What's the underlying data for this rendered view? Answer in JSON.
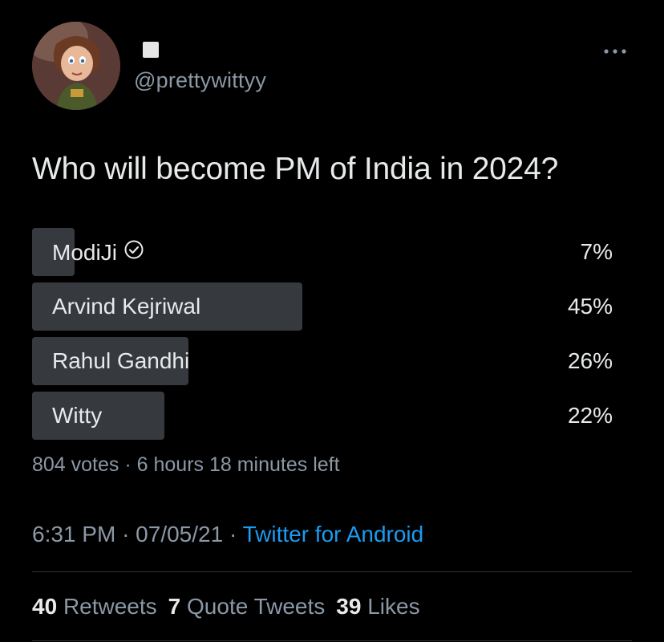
{
  "tweet": {
    "handle": "@prettywittyy",
    "more_icon": "more-horizontal-icon",
    "question": "Who will become PM of India in 2024?",
    "poll": {
      "options": [
        {
          "label": "ModiJi",
          "percent_text": "7%",
          "percent": 7,
          "verified_icon": "check-circle-icon"
        },
        {
          "label": "Arvind Kejriwal",
          "percent_text": "45%",
          "percent": 45
        },
        {
          "label": "Rahul Gandhi",
          "percent_text": "26%",
          "percent": 26
        },
        {
          "label": "Witty",
          "percent_text": "22%",
          "percent": 22
        }
      ],
      "meta": "804 votes · 6 hours 18 minutes left"
    },
    "time": "6:31 PM",
    "date": "07/05/21",
    "separator": "·",
    "source": "Twitter for Android",
    "stats": {
      "retweets_count": "40",
      "retweets_label": "Retweets",
      "quotes_count": "7",
      "quotes_label": "Quote Tweets",
      "likes_count": "39",
      "likes_label": "Likes"
    }
  },
  "colors": {
    "background": "#000000",
    "text": "#e7e9ea",
    "muted": "#8b98a5",
    "link": "#1d9bf0",
    "bar": "#36393d"
  }
}
